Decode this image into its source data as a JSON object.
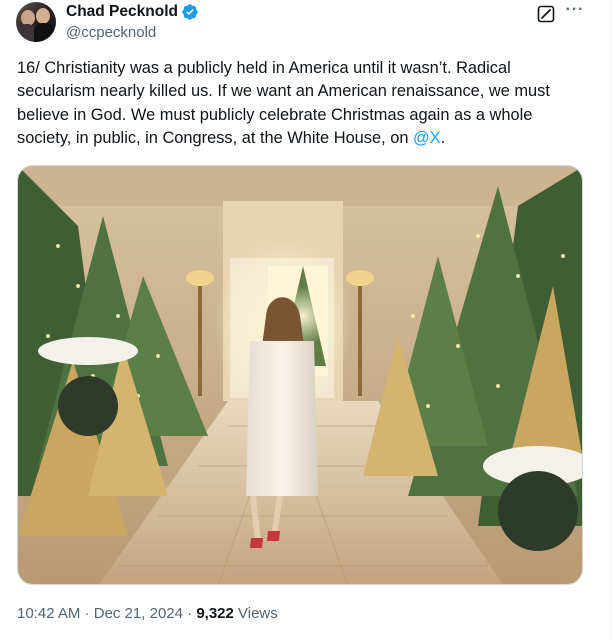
{
  "author": {
    "display_name": "Chad Pecknold",
    "handle": "@ccpecknold",
    "verified": true,
    "verified_color": "#1d9bf0"
  },
  "icons": {
    "verified": "verified-badge-icon",
    "grok": "grok-icon",
    "more": "more-options-icon"
  },
  "tweet": {
    "text_before_mention": "16/ Christianity was a publicly held in America until it wasn’t. Radical secularism nearly killed us. If we want an American renaissance, we must believe in God. We must publicly celebrate Christmas again as a whole society, in public, in Congress, at the White House, on ",
    "mention": "@X",
    "text_after_mention": ".",
    "mention_color": "#1d9bf0"
  },
  "media": {
    "kind": "photo"
  },
  "meta": {
    "time": "10:42 AM",
    "separator": " · ",
    "date": "Dec 21, 2024",
    "views_count": "9,322",
    "views_label": " Views"
  },
  "more_glyph": "···"
}
